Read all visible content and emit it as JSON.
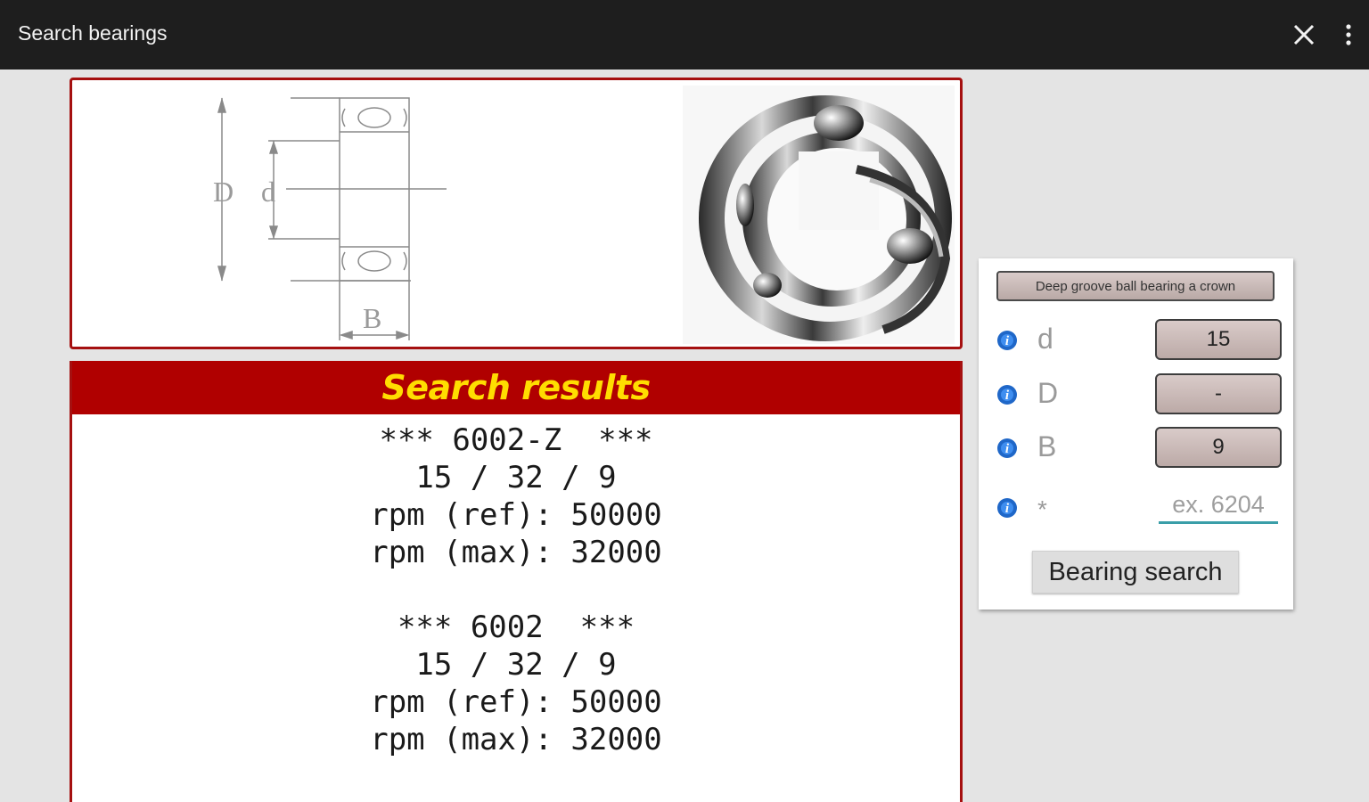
{
  "appbar": {
    "title": "Search bearings",
    "close_icon": "close-icon",
    "menu_icon": "overflow-menu-icon",
    "background": "#1e1e1e"
  },
  "diagram": {
    "labels": {
      "outer_diameter": "D",
      "inner_diameter": "d",
      "width": "B"
    }
  },
  "results": {
    "title": "Search results",
    "header_color": "#b00000",
    "title_color": "#ffdd00",
    "items": [
      {
        "name": "*** 6002-Z  ***",
        "dims": "15 / 32 / 9",
        "rpm_ref": "rpm (ref): 50000",
        "rpm_max": "rpm (max): 32000"
      },
      {
        "name": "*** 6002  ***",
        "dims": "15 / 32 / 9",
        "rpm_ref": "rpm (ref): 50000",
        "rpm_max": "rpm (max): 32000"
      }
    ]
  },
  "form": {
    "type_button": "Deep groove ball bearing a crown",
    "params": [
      {
        "label": "d",
        "value": "15"
      },
      {
        "label": "D",
        "value": "-"
      },
      {
        "label": "B",
        "value": "9"
      }
    ],
    "search": {
      "label": "*",
      "placeholder": "ex. 6204",
      "value": ""
    },
    "search_button": "Bearing search",
    "info_icon": "info-icon",
    "accent": "#3a9ea8"
  }
}
